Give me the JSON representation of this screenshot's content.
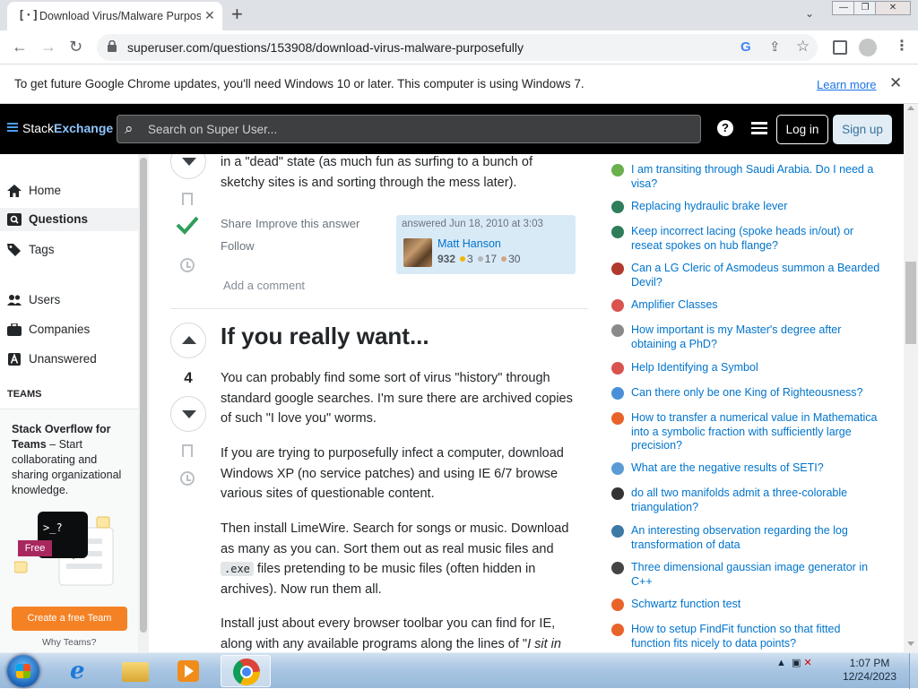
{
  "browser": {
    "tab_title": "Download Virus/Malware Purposefully",
    "tab_icon": "stack-exchange-favicon",
    "url": "superuser.com/questions/153908/download-virus-malware-purposefully",
    "new_tab": "+",
    "win_min": "—",
    "win_max": "❐",
    "win_close": "✕"
  },
  "infobar": {
    "message": "To get future Google Chrome updates, you'll need Windows 10 or later. This computer is using Windows 7.",
    "learn_more": "Learn more"
  },
  "se_header": {
    "logo_a": "Stack",
    "logo_b": "Exchange",
    "search_placeholder": "Search on Super User...",
    "login": "Log in",
    "signup": "Sign up"
  },
  "left_nav": {
    "items": [
      "Home",
      "Questions",
      "Tags",
      "Users",
      "Companies",
      "Unanswered"
    ],
    "active": "Questions",
    "teams_label": "TEAMS",
    "teams_heading": "Stack Overflow for Teams",
    "teams_body": "– Start collaborating and sharing organizational knowledge.",
    "free_badge": "Free",
    "cta": "Create a free Team",
    "why": "Why Teams?"
  },
  "prev_answer": {
    "tail_line1": "in a \"dead\" state (as much fun as surfing to a bunch of",
    "tail_line2": "sketchy sites is and sorting through the mess later).",
    "share": "Share",
    "improve": "Improve this answer",
    "follow": "Follow",
    "answered": "answered Jun 18, 2010 at 3:03",
    "user": "Matt Hanson",
    "rep": "932",
    "gold": "3",
    "silver": "17",
    "bronze": "30",
    "add_comment": "Add a comment"
  },
  "answer": {
    "score": "4",
    "heading": "If you really want...",
    "p1": "You can probably find some sort of virus \"history\" through standard google searches. I'm sure there are archived copies of such \"I love you\" worms.",
    "p2": "If you are trying to purposefully infect a computer, download Windows XP (no service patches) and using IE 6/7 browse various sites of questionable content.",
    "p3a": "Then install LimeWire. Search for songs or music. Download as many as you can. Sort them out as real music files and ",
    "p3code": ".exe",
    "p3b": " files pretending to be music files (often hidden in archives). Now run them all.",
    "p4a": "Install just about every browser toolbar you can find for IE, along with any available programs along the lines of \"",
    "p4em": "I sit in"
  },
  "hot_questions": [
    {
      "q": "I am transiting through Saudi Arabia. Do I need a visa?",
      "color": "#6ab04c"
    },
    {
      "q": "Replacing hydraulic brake lever",
      "color": "#2e7d5b"
    },
    {
      "q": "Keep incorrect lacing (spoke heads in/out) or reseat spokes on hub flange?",
      "color": "#2e7d5b"
    },
    {
      "q": "Can a LG Cleric of Asmodeus summon a Bearded Devil?",
      "color": "#b03a2e"
    },
    {
      "q": "Amplifier Classes",
      "color": "#d9534f"
    },
    {
      "q": "How important is my Master's degree after obtaining a PhD?",
      "color": "#8a8a8a"
    },
    {
      "q": "Help Identifying a Symbol",
      "color": "#d9534f"
    },
    {
      "q": "Can there only be one King of Righteousness?",
      "color": "#4a90d9"
    },
    {
      "q": "How to transfer a numerical value in Mathematica into a symbolic fraction with sufficiently large precision?",
      "color": "#e8632a"
    },
    {
      "q": "What are the negative results of SETI?",
      "color": "#5b9bd5"
    },
    {
      "q": "do all two manifolds admit a three-colorable triangulation?",
      "color": "#333333"
    },
    {
      "q": "An interesting observation regarding the log transformation of data",
      "color": "#3c7aa6"
    },
    {
      "q": "Three dimensional gaussian image generator in C++",
      "color": "#444444"
    },
    {
      "q": "Schwartz function test",
      "color": "#e8632a"
    },
    {
      "q": "How to setup FindFit function so that fitted function fits nicely to data points?",
      "color": "#e8632a"
    }
  ],
  "taskbar": {
    "time": "1:07 PM",
    "date": "12/24/2023"
  }
}
